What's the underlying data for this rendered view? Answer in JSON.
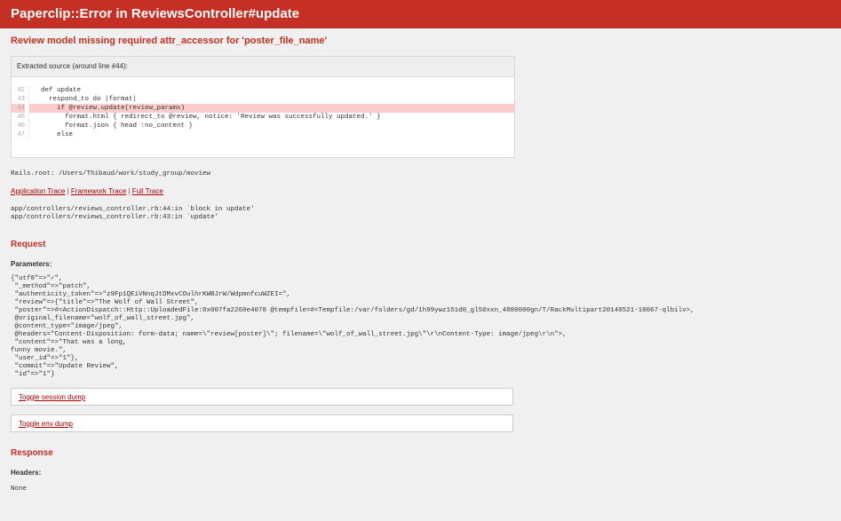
{
  "header": {
    "title": "Paperclip::Error in ReviewsController#update"
  },
  "error": {
    "message": "Review model missing required attr_accessor for 'poster_file_name'"
  },
  "source": {
    "heading": "Extracted source (around line #44):",
    "lines": [
      {
        "num": "42",
        "code": "  def update",
        "highlight": false
      },
      {
        "num": "43",
        "code": "    respond_to do |format|",
        "highlight": false
      },
      {
        "num": "44",
        "code": "      if @review.update(review_params)",
        "highlight": true
      },
      {
        "num": "45",
        "code": "        format.html { redirect_to @review, notice: 'Review was successfully updated.' }",
        "highlight": false
      },
      {
        "num": "46",
        "code": "        format.json { head :no_content }",
        "highlight": false
      },
      {
        "num": "47",
        "code": "      else",
        "highlight": false
      }
    ]
  },
  "rails_root": "Rails.root: /Users/Thibaud/work/study_group/moview",
  "traces": {
    "application": "Application Trace",
    "framework": "Framework Trace",
    "full": "Full Trace",
    "separator": "|",
    "lines": [
      "app/controllers/reviews_controller.rb:44:in `block in update'",
      "app/controllers/reviews_controller.rb:43:in `update'"
    ]
  },
  "request": {
    "heading": "Request",
    "params_label": "Parameters:",
    "params_lines": [
      "{\"utf8\"=>\"✓\",",
      " \"_method\"=>\"patch\",",
      " \"authenticity_token\"=>\"z9Fp1QEiVNnqJtDMxvCOulhrKWBJrW/WdpmnfcuWZEI=\",",
      " \"review\"=>{\"title\"=>\"The Wolf of Wall Street\",",
      " \"poster\"=>#<ActionDispatch::Http::UploadedFile:0x007fa2260e4078 @tempfile=#<Tempfile:/var/folders/gd/1h99ywz151d0_gl50xxn_4880000gn/T/RackMultipart20140521-10067-qlbilv>,",
      " @original_filename=\"wolf_of_wall_street.jpg\",",
      " @content_type=\"image/jpeg\",",
      " @headers=\"Content-Disposition: form-data; name=\\\"review[poster]\\\"; filename=\\\"wolf_of_wall_street.jpg\\\"\\r\\nContent-Type: image/jpeg\\r\\n\">,",
      " \"content\"=>\"That was a long,",
      "funny movie.\",",
      " \"user_id\"=>\"1\"},",
      " \"commit\"=>\"Update Review\",",
      " \"id\"=>\"1\"}"
    ],
    "toggle_session": "Toggle session dump",
    "toggle_env": "Toggle env dump"
  },
  "response": {
    "heading": "Response",
    "headers_label": "Headers:",
    "headers_value": "None"
  }
}
